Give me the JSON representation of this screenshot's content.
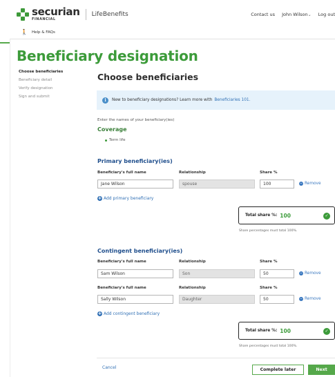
{
  "header": {
    "brand_name": "securian",
    "brand_sub": "FINANCIAL",
    "product": "LifeBenefits",
    "links": [
      "Contact us",
      "John Wilson",
      "Log out"
    ]
  },
  "helpbar": {
    "label": "Help & FAQs"
  },
  "page_title": "Beneficiary designation",
  "steps": [
    "Choose beneficiaries",
    "Beneficiary detail",
    "Verify designation",
    "Sign and submit"
  ],
  "section_title": "Choose beneficiaries",
  "info": {
    "text": "New to beneficiary designations? Learn more with",
    "link": "Beneficiaries 101."
  },
  "instruction": "Enter the names of your beneficiary(ies)",
  "coverage": {
    "title": "Coverage",
    "item": "Term life"
  },
  "columns": {
    "name": "Beneficiary's full name",
    "relationship": "Relationship",
    "share": "Share %"
  },
  "primary": {
    "title": "Primary beneficiary(ies)",
    "rows": [
      {
        "name": "Jane Wilson",
        "relationship": "spouse",
        "share": "100"
      }
    ],
    "add_label": "Add primary beneficiary",
    "total_label": "Total share %:",
    "total_value": "100",
    "note": "Share percentages must total 100%."
  },
  "contingent": {
    "title": "Contingent beneficiary(ies)",
    "rows": [
      {
        "name": "Sam Wilson",
        "relationship": "Son",
        "share": "50"
      },
      {
        "name": "Sally Wilson",
        "relationship": "Daughter",
        "share": "50"
      }
    ],
    "add_label": "Add contingent beneficiary",
    "total_label": "Total share %:",
    "total_value": "100",
    "note": "Share percentages must total 100%."
  },
  "remove_label": "Remove",
  "footer": {
    "cancel": "Cancel",
    "later": "Complete later",
    "next": "Next"
  },
  "colors": {
    "brand_green": "#3c9b3a",
    "link_blue": "#2f6fb4",
    "info_bg": "#e6f2fb",
    "heading_blue": "#1f4e8c"
  }
}
